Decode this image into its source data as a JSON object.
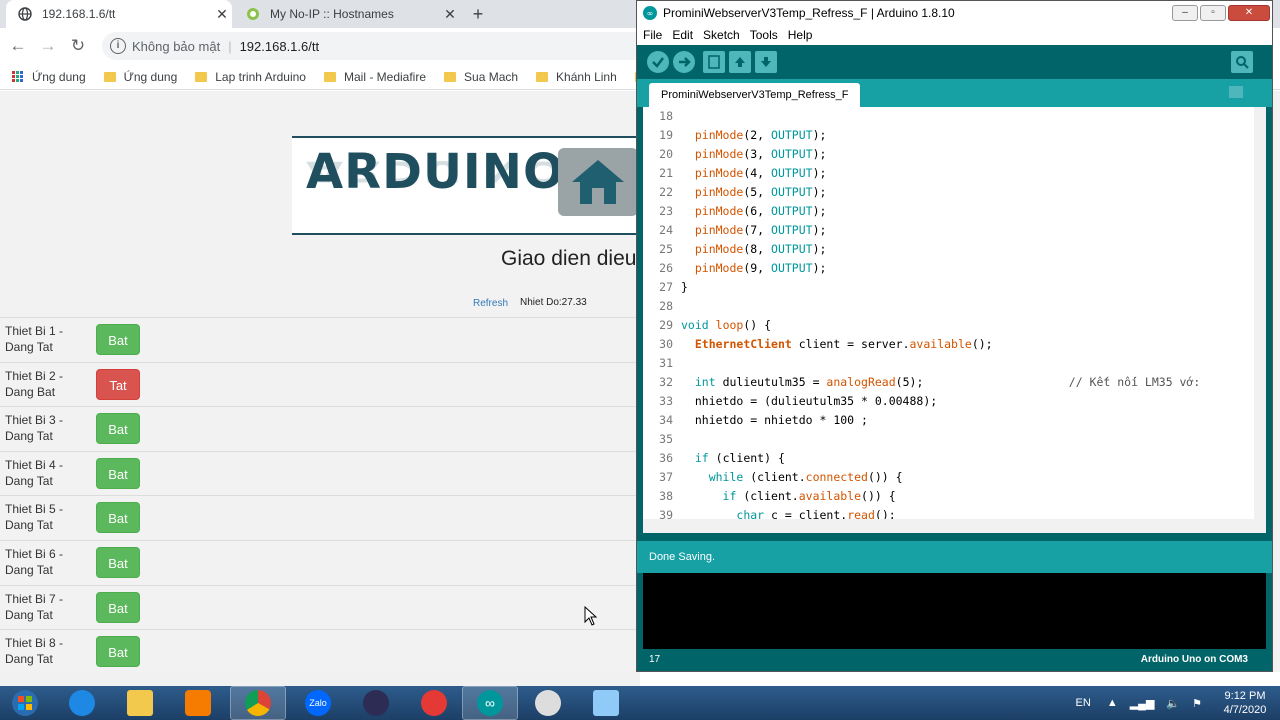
{
  "browser": {
    "tabs": [
      {
        "title": "192.168.1.6/tt"
      },
      {
        "title": "My No-IP :: Hostnames"
      }
    ],
    "omnibox": {
      "security": "Không bảo mật",
      "url": "192.168.1.6/tt"
    },
    "bookmarks": [
      "Ứng dung",
      "Ứng dung",
      "Lap trinh Arduino",
      "Mail - Mediafire",
      "Sua Mach",
      "Khánh Linh"
    ]
  },
  "webpage": {
    "logo_text": "ARDUINO",
    "heading": "Giao dien dieu",
    "refresh_label": "Refresh",
    "temperature": "Nhiet Do:27.33",
    "devices": [
      {
        "label": "Thiet Bi 1 - Dang Tat",
        "button": "Bat",
        "state": "off"
      },
      {
        "label": "Thiet Bi 2 - Dang Bat",
        "button": "Tat",
        "state": "on"
      },
      {
        "label": "Thiet Bi 3 - Dang Tat",
        "button": "Bat",
        "state": "off"
      },
      {
        "label": "Thiet Bi 4 - Dang Tat",
        "button": "Bat",
        "state": "off"
      },
      {
        "label": "Thiet Bi 5 - Dang Tat",
        "button": "Bat",
        "state": "off"
      },
      {
        "label": "Thiet Bi 6 - Dang Tat",
        "button": "Bat",
        "state": "off"
      },
      {
        "label": "Thiet Bi 7 - Dang Tat",
        "button": "Bat",
        "state": "off"
      },
      {
        "label": "Thiet Bi 8 - Dang Tat",
        "button": "Bat",
        "state": "off"
      }
    ]
  },
  "ide": {
    "title": "ProminiWebserverV3Temp_Refress_F | Arduino 1.8.10",
    "menus": [
      "File",
      "Edit",
      "Sketch",
      "Tools",
      "Help"
    ],
    "sketch_tab": "ProminiWebserverV3Temp_Refress_F",
    "code": [
      {
        "n": "18",
        "t": ""
      },
      {
        "n": "19",
        "t": "  pinMode(2, OUTPUT);"
      },
      {
        "n": "20",
        "t": "  pinMode(3, OUTPUT);"
      },
      {
        "n": "21",
        "t": "  pinMode(4, OUTPUT);"
      },
      {
        "n": "22",
        "t": "  pinMode(5, OUTPUT);"
      },
      {
        "n": "23",
        "t": "  pinMode(6, OUTPUT);"
      },
      {
        "n": "24",
        "t": "  pinMode(7, OUTPUT);"
      },
      {
        "n": "25",
        "t": "  pinMode(8, OUTPUT);"
      },
      {
        "n": "26",
        "t": "  pinMode(9, OUTPUT);"
      },
      {
        "n": "27",
        "t": "}"
      },
      {
        "n": "28",
        "t": ""
      },
      {
        "n": "29",
        "t": "void loop() {"
      },
      {
        "n": "30",
        "t": "  EthernetClient client = server.available();"
      },
      {
        "n": "31",
        "t": ""
      },
      {
        "n": "32",
        "t": "  int dulieutulm35 = analogRead(5);                     // Kết nối LM35 vớ:"
      },
      {
        "n": "33",
        "t": "  nhietdo = (dulieutulm35 * 0.00488);"
      },
      {
        "n": "34",
        "t": "  nhietdo = nhietdo * 100 ;"
      },
      {
        "n": "35",
        "t": ""
      },
      {
        "n": "36",
        "t": "  if (client) {"
      },
      {
        "n": "37",
        "t": "    while (client.connected()) {"
      },
      {
        "n": "38",
        "t": "      if (client.available()) {"
      },
      {
        "n": "39",
        "t": "        char c = client.read();"
      }
    ],
    "status": "Done Saving.",
    "footer_line": "17",
    "footer_board": "Arduino Uno on COM3"
  },
  "taskbar": {
    "language": "EN",
    "time": "9:12 PM",
    "date": "4/7/2020"
  }
}
